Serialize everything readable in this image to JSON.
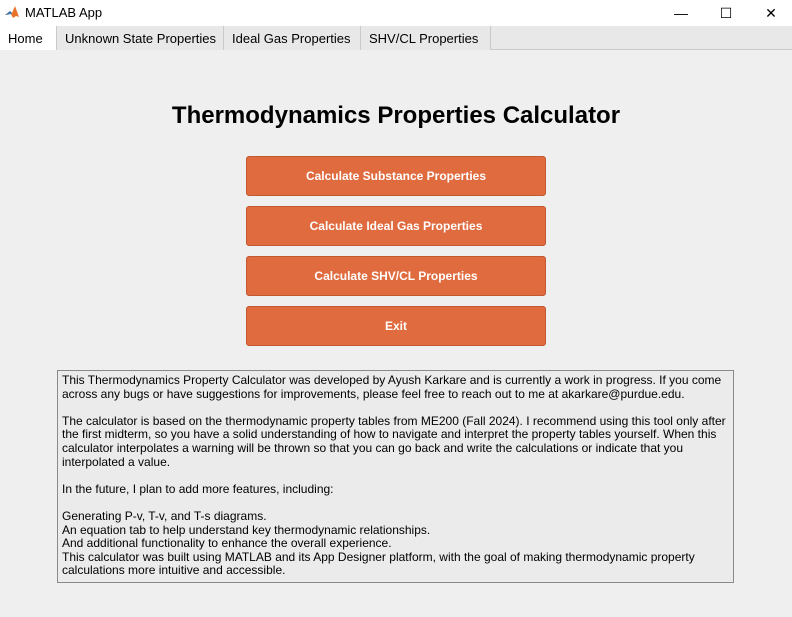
{
  "window": {
    "title": "MATLAB App",
    "minimize_glyph": "—",
    "maximize_glyph": "☐",
    "close_glyph": "✕"
  },
  "tabs": [
    {
      "label": "Home",
      "active": true
    },
    {
      "label": "Unknown State Properties",
      "active": false
    },
    {
      "label": "Ideal Gas Properties",
      "active": false
    },
    {
      "label": "SHV/CL Properties",
      "active": false
    }
  ],
  "main": {
    "title": "Thermodynamics Properties Calculator",
    "buttons": {
      "substance": "Calculate Substance Properties",
      "ideal_gas": "Calculate Ideal Gas Properties",
      "shv_cl": "Calculate SHV/CL Properties",
      "exit": "Exit"
    },
    "info_lines": [
      "This Thermodynamics Property Calculator was developed by Ayush Karkare and is currently a work in progress. If you come across any bugs or have suggestions for improvements, please feel free to reach out to me at akarkare@purdue.edu.",
      "",
      "The calculator is based on the thermodynamic property tables from ME200 (Fall 2024). I recommend using this tool only after the first midterm, so you have a solid understanding of how to navigate and interpret the property tables yourself. When this calculator interpolates a warning will be thrown so that you can go back and write the calculations or indicate that you interpolated a value.",
      "",
      "In the future, I plan to add more features, including:",
      "",
      "Generating P-v, T-v, and T-s diagrams.",
      "An equation tab to help understand key thermodynamic relationships.",
      "And additional functionality to enhance the overall experience.",
      "This calculator was built using MATLAB and its App Designer platform, with the goal of making thermodynamic property calculations more intuitive and accessible."
    ]
  },
  "colors": {
    "button_bg": "#e06b3f",
    "button_text": "#ffffff",
    "background": "#efefef"
  },
  "icons": {
    "app": "matlab-logo-icon"
  }
}
